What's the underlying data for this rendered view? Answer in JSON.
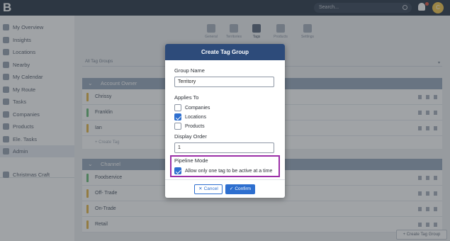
{
  "topbar": {
    "logo": "B",
    "search_placeholder": "Search...",
    "avatar_initial": "C"
  },
  "sidebar": {
    "items": [
      {
        "label": "My Overview"
      },
      {
        "label": "Insights"
      },
      {
        "label": "Locations"
      },
      {
        "label": "Nearby"
      },
      {
        "label": "My Calendar"
      },
      {
        "label": "My Route"
      },
      {
        "label": "Tasks"
      },
      {
        "label": "Companies"
      },
      {
        "label": "Products"
      },
      {
        "label": "Ele. Tasks"
      },
      {
        "label": "Admin"
      }
    ],
    "extra": "Christmas Craft"
  },
  "tabs": [
    "General",
    "Territories",
    "Tags",
    "Products",
    "Settings"
  ],
  "filter": {
    "value": "All Tag Groups"
  },
  "groups": [
    {
      "title": "Account Owner",
      "rows": [
        "Chrissy",
        "Franklin",
        "Ian"
      ],
      "add_label": "+ Create Tag"
    },
    {
      "title": "Channel",
      "rows": [
        "Foodservice",
        "Off- Trade",
        "On-Trade",
        "Retail"
      ]
    }
  ],
  "row_colors": [
    "#e8b94a",
    "#6cbf7a",
    "#e8b94a",
    "#6cbf7a",
    "#e8b94a",
    "#e8b94a",
    "#e8b94a"
  ],
  "footer": {
    "create_group": "+ Create Tag Group"
  },
  "modal": {
    "title": "Create Tag Group",
    "group_name_label": "Group Name",
    "group_name_value": "Territory",
    "applies_to_label": "Applies To",
    "applies_to": [
      {
        "label": "Companies",
        "checked": false
      },
      {
        "label": "Locations",
        "checked": true
      },
      {
        "label": "Products",
        "checked": false
      }
    ],
    "display_order_label": "Display Order",
    "display_order_value": "1",
    "pipeline_label": "Pipeline Mode",
    "pipeline_option": "Allow only one tag to be active at a time",
    "pipeline_checked": true,
    "cancel_label": "Cancel",
    "confirm_label": "Confirm"
  },
  "colors": {
    "modal_header": "#2d4b7a",
    "accent": "#2e6fcf",
    "highlight": "#9b2fa7"
  }
}
